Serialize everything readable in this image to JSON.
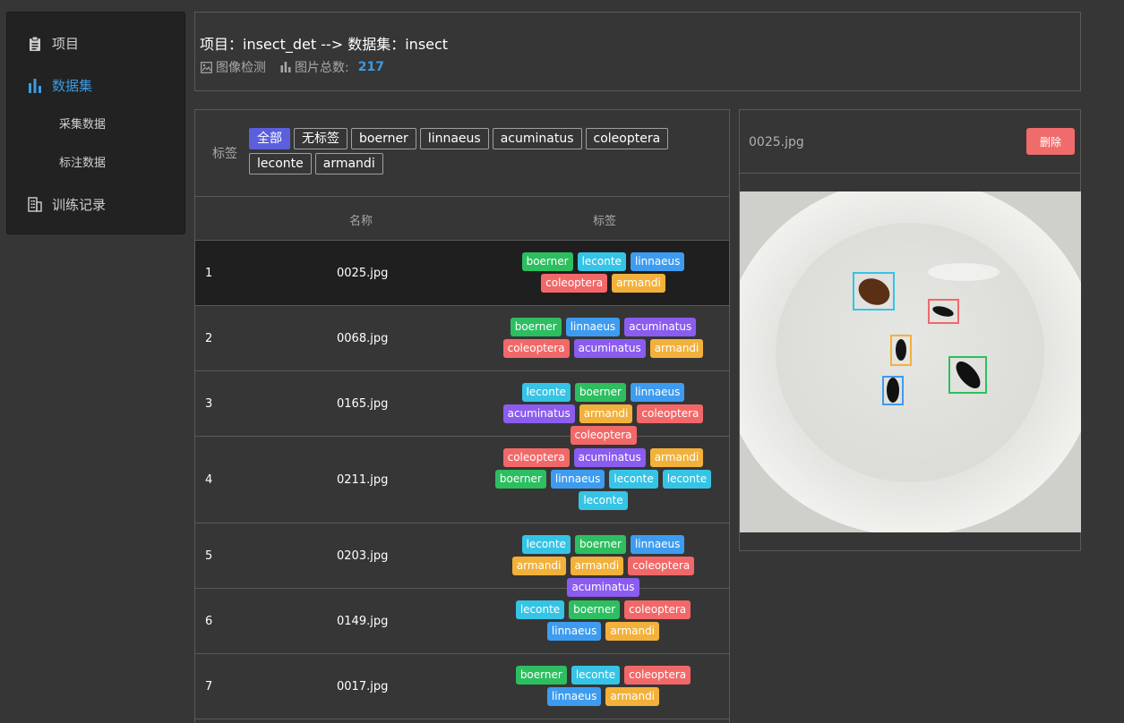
{
  "sidebar": {
    "items": [
      {
        "label": "项目",
        "icon": "clipboard-icon"
      },
      {
        "label": "数据集",
        "icon": "bar-chart-icon",
        "active": true
      },
      {
        "label": "训练记录",
        "icon": "building-icon"
      }
    ],
    "sub_items": [
      "采集数据",
      "标注数据"
    ]
  },
  "header": {
    "title": "项目：insect_det --> 数据集：insect",
    "task_type": "图像检测",
    "count_label": "图片总数:",
    "count_value": "217"
  },
  "filter": {
    "label": "标签",
    "tags": [
      "全部",
      "无标签",
      "boerner",
      "linnaeus",
      "acuminatus",
      "coleoptera",
      "leconte",
      "armandi"
    ],
    "active": "全部"
  },
  "table": {
    "headers": {
      "name": "名称",
      "tags": "标签"
    },
    "rows": [
      {
        "idx": "1",
        "name": "0025.jpg",
        "tags": [
          "boerner",
          "leconte",
          "linnaeus",
          "coleoptera",
          "armandi"
        ]
      },
      {
        "idx": "2",
        "name": "0068.jpg",
        "tags": [
          "boerner",
          "linnaeus",
          "acuminatus",
          "coleoptera",
          "acuminatus",
          "armandi"
        ]
      },
      {
        "idx": "3",
        "name": "0165.jpg",
        "tags": [
          "leconte",
          "boerner",
          "linnaeus",
          "acuminatus",
          "armandi",
          "coleoptera",
          "coleoptera"
        ]
      },
      {
        "idx": "4",
        "name": "0211.jpg",
        "tags": [
          "coleoptera",
          "acuminatus",
          "armandi",
          "boerner",
          "linnaeus",
          "leconte",
          "leconte",
          "leconte"
        ]
      },
      {
        "idx": "5",
        "name": "0203.jpg",
        "tags": [
          "leconte",
          "boerner",
          "linnaeus",
          "armandi",
          "armandi",
          "coleoptera",
          "acuminatus"
        ]
      },
      {
        "idx": "6",
        "name": "0149.jpg",
        "tags": [
          "leconte",
          "boerner",
          "coleoptera",
          "linnaeus",
          "armandi"
        ]
      },
      {
        "idx": "7",
        "name": "0017.jpg",
        "tags": [
          "boerner",
          "leconte",
          "coleoptera",
          "linnaeus",
          "armandi"
        ]
      }
    ]
  },
  "tag_colors": {
    "boerner": "#2dbe60",
    "leconte": "#35c4e6",
    "linnaeus": "#3e9cf0",
    "coleoptera": "#f26868",
    "armandi": "#f2b13b",
    "acuminatus": "#8b5cf0"
  },
  "detail": {
    "filename": "0025.jpg",
    "delete_label": "删除"
  }
}
